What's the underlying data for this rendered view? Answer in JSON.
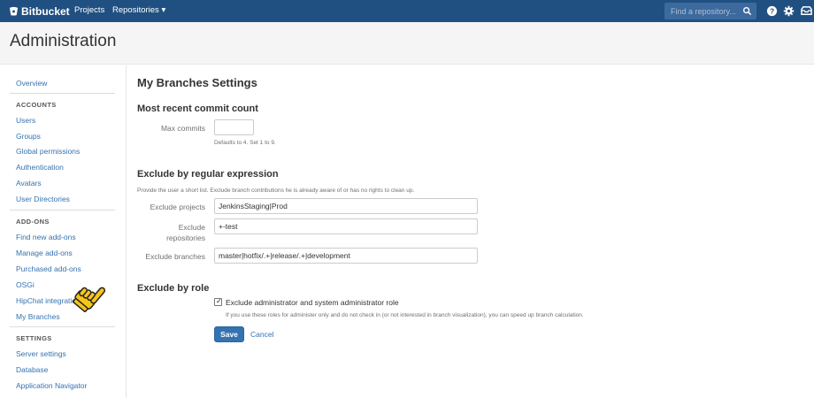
{
  "topbar": {
    "logo": "Bitbucket",
    "nav": [
      "Projects",
      "Repositories ▾"
    ],
    "search_placeholder": "Find a repository...",
    "icons": [
      "search-icon",
      "help-icon",
      "gear-icon",
      "inbox-icon"
    ]
  },
  "header": {
    "title": "Administration"
  },
  "sidebar": {
    "overview": "Overview",
    "accounts_heading": "ACCOUNTS",
    "accounts": [
      "Users",
      "Groups",
      "Global permissions",
      "Authentication",
      "Avatars",
      "User Directories"
    ],
    "addons_heading": "ADD-ONS",
    "addons": [
      "Find new add-ons",
      "Manage add-ons",
      "Purchased add-ons",
      "OSGi",
      "HipChat integration",
      "My Branches"
    ],
    "settings_heading": "SETTINGS",
    "settings": [
      "Server settings",
      "Database",
      "Application Navigator"
    ]
  },
  "main": {
    "title": "My Branches Settings",
    "commit": {
      "heading": "Most recent commit count",
      "label": "Max commits",
      "value": "",
      "help": "Defaults to 4. Set 1 to 9."
    },
    "regex": {
      "heading": "Exclude by regular expression",
      "description": "Provide the user a short list. Exclude branch contributions he is already aware of or has no rights to clean up.",
      "projects_label": "Exclude projects",
      "projects_value": "JenkinsStaging|Prod",
      "repos_label_1": "Exclude",
      "repos_label_2": "repositories",
      "repos_value": "+-test",
      "branches_label": "Exclude branches",
      "branches_value": "master|hotfix/.+|release/.+|development"
    },
    "role": {
      "heading": "Exclude by role",
      "checkbox_label": "Exclude administrator and system administrator role",
      "checked": true,
      "check_glyph": "✓",
      "help": "If you use these roles for administer only and do not check in (or not interested in branch visualization), you can speed up branch calculation."
    },
    "save": "Save",
    "cancel": "Cancel"
  },
  "overlay": {
    "cursor_icon": "hand-pointer-icon",
    "cursor_color": "#f5c518"
  }
}
